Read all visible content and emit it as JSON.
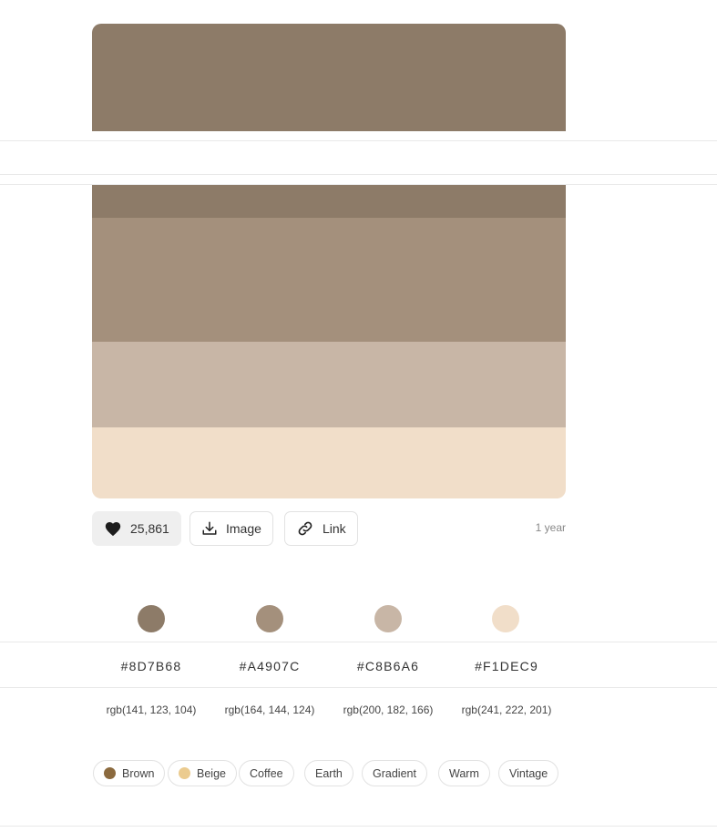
{
  "palette": {
    "swatches": [
      {
        "hex": "#8D7B68"
      },
      {
        "hex": "#A4907C"
      },
      {
        "hex": "#C8B6A6"
      },
      {
        "hex": "#F1DEC9"
      }
    ]
  },
  "actions": {
    "like_count": "25,861",
    "image_label": "Image",
    "link_label": "Link",
    "age": "1 year"
  },
  "colors": [
    {
      "hex": "#8D7B68",
      "rgb": "rgb(141, 123, 104)"
    },
    {
      "hex": "#A4907C",
      "rgb": "rgb(164, 144, 124)"
    },
    {
      "hex": "#C8B6A6",
      "rgb": "rgb(200, 182, 166)"
    },
    {
      "hex": "#F1DEC9",
      "rgb": "rgb(241, 222, 201)"
    }
  ],
  "tags": [
    {
      "label": "Brown",
      "color": "#8B6A3E"
    },
    {
      "label": "Beige",
      "color": "#EBCB8F"
    },
    {
      "label": "Coffee"
    },
    {
      "label": "Earth"
    },
    {
      "label": "Gradient"
    },
    {
      "label": "Warm"
    },
    {
      "label": "Vintage"
    }
  ]
}
